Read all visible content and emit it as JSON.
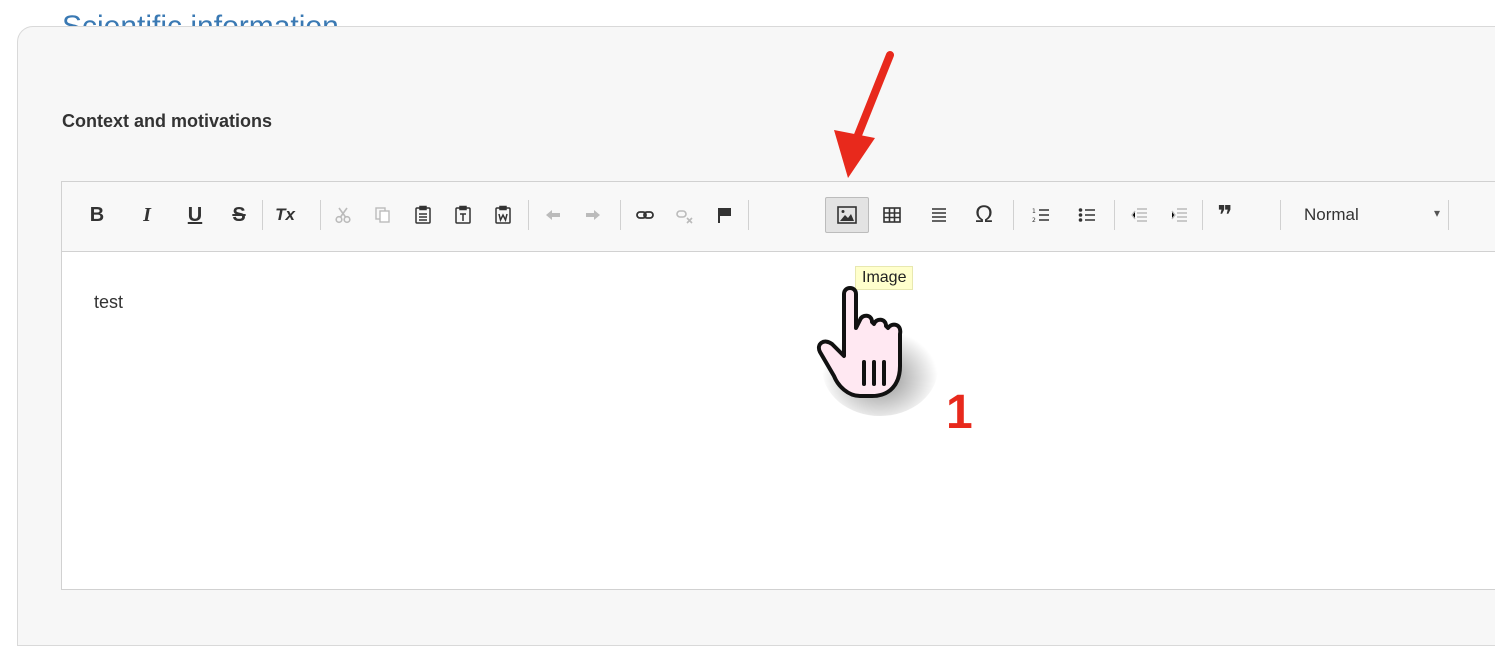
{
  "section": {
    "legend": "Scientific information",
    "field_label": "Context and motivations"
  },
  "toolbar": {
    "buttons": [
      {
        "name": "bold-button",
        "label": "B"
      },
      {
        "name": "italic-button",
        "label": "I"
      },
      {
        "name": "underline-button",
        "label": "U"
      },
      {
        "name": "strike-button",
        "label": "S"
      },
      {
        "name": "remove-format-button",
        "label": "Tx"
      },
      {
        "name": "cut-button",
        "icon": "scissors-icon"
      },
      {
        "name": "copy-button",
        "icon": "copy-icon"
      },
      {
        "name": "paste-button",
        "icon": "paste-icon"
      },
      {
        "name": "paste-text-button",
        "icon": "paste-text-icon"
      },
      {
        "name": "paste-word-button",
        "icon": "paste-word-icon"
      },
      {
        "name": "undo-button",
        "icon": "undo-icon"
      },
      {
        "name": "redo-button",
        "icon": "redo-icon"
      },
      {
        "name": "link-button",
        "icon": "link-icon"
      },
      {
        "name": "unlink-button",
        "icon": "unlink-icon"
      },
      {
        "name": "anchor-button",
        "icon": "flag-icon"
      },
      {
        "name": "image-button",
        "icon": "image-icon"
      },
      {
        "name": "table-button",
        "icon": "table-icon"
      },
      {
        "name": "horizontal-rule-button",
        "icon": "horizontal-rule-icon"
      },
      {
        "name": "special-char-button",
        "label": "Ω"
      },
      {
        "name": "numbered-list-button",
        "icon": "numbered-list-icon"
      },
      {
        "name": "bulleted-list-button",
        "icon": "bulleted-list-icon"
      },
      {
        "name": "outdent-button",
        "icon": "outdent-icon"
      },
      {
        "name": "indent-button",
        "icon": "indent-icon"
      },
      {
        "name": "blockquote-button",
        "label": "❞"
      }
    ],
    "format_value": "Normal",
    "format_caret": "▾"
  },
  "editor": {
    "content": "test"
  },
  "tooltip": {
    "text": "Image"
  },
  "annotation": {
    "step_number": "1",
    "arrow_color": "#e8291c"
  }
}
